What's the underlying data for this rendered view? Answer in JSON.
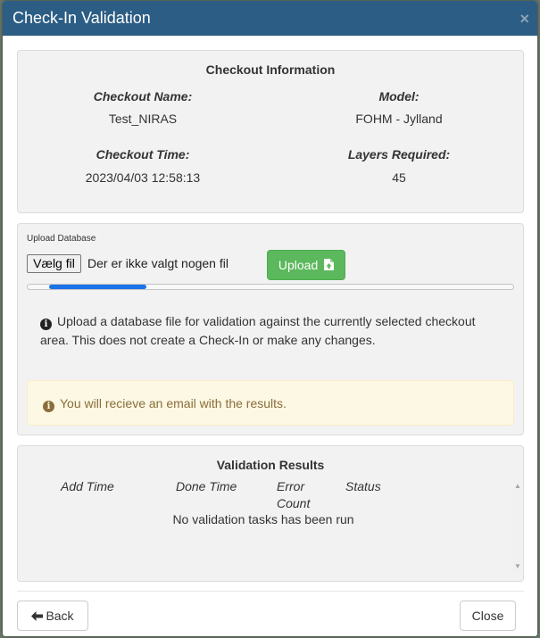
{
  "dialog": {
    "title": "Check-In Validation",
    "close_symbol": "×"
  },
  "checkout": {
    "heading": "Checkout Information",
    "name_label": "Checkout Name:",
    "name_value": "Test_NIRAS",
    "model_label": "Model:",
    "model_value": "FOHM - Jylland",
    "time_label": "Checkout Time:",
    "time_value": "2023/04/03 12:58:13",
    "layers_label": "Layers Required:",
    "layers_value": "45"
  },
  "upload": {
    "section_label": "Upload Database",
    "choose_file_label": "Vælg fil",
    "no_file_text": "Der er ikke valgt nogen fil",
    "upload_button": "Upload",
    "progress_fraction": 0.2,
    "info_text": "Upload a database file for validation against the currently selected checkout area. This does not create a Check-In or make any changes.",
    "notice_text": "You will recieve an email with the results."
  },
  "results": {
    "heading": "Validation Results",
    "col_add_time": "Add Time",
    "col_done_time": "Done Time",
    "col_error_1": "Error",
    "col_error_2": "Count",
    "col_status": "Status",
    "empty_message": "No validation tasks has been run"
  },
  "footer": {
    "back_label": "Back",
    "close_label": "Close"
  },
  "colors": {
    "header": "#2c5d84",
    "upload_button": "#5cb85c",
    "progress": "#1a73e8",
    "notice_bg": "#fcf8e3"
  }
}
